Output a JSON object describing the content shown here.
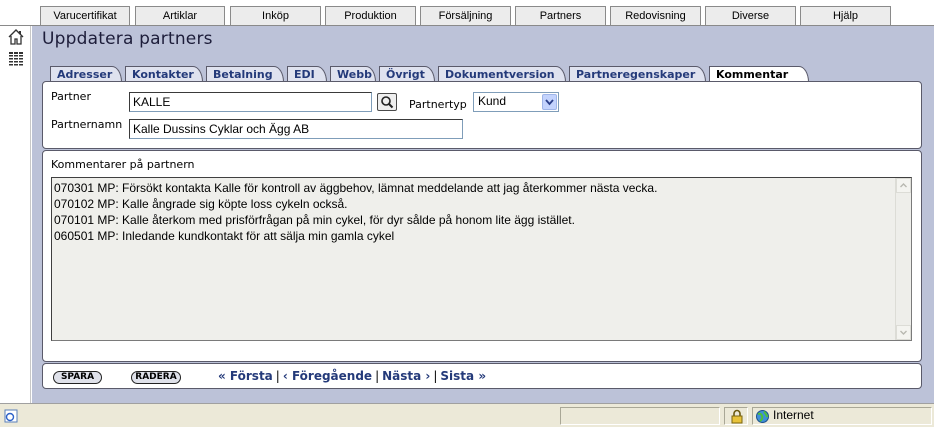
{
  "menu": {
    "items": [
      {
        "label": "Varucertifikat"
      },
      {
        "label": "Artiklar"
      },
      {
        "label": "Inköp"
      },
      {
        "label": "Produktion"
      },
      {
        "label": "Försäljning"
      },
      {
        "label": "Partners"
      },
      {
        "label": "Redovisning"
      },
      {
        "label": "Diverse"
      },
      {
        "label": "Hjälp"
      }
    ]
  },
  "page": {
    "title": "Uppdatera partners"
  },
  "tabs": [
    {
      "label": "Adresser"
    },
    {
      "label": "Kontakter"
    },
    {
      "label": "Betalning"
    },
    {
      "label": "EDI"
    },
    {
      "label": "Webb"
    },
    {
      "label": "Övrigt"
    },
    {
      "label": "Dokumentversion"
    },
    {
      "label": "Partneregenskaper"
    },
    {
      "label": "Kommentar",
      "active": true
    }
  ],
  "form": {
    "partner_label": "Partner",
    "partner_value": "KALLE",
    "partnertyp_label": "Partnertyp",
    "partnertyp_value": "Kund",
    "partnernamn_label": "Partnernamn",
    "partnernamn_value": "Kalle Dussins Cyklar och Ägg AB"
  },
  "comments": {
    "label": "Kommentarer på partnern",
    "lines": [
      "070301 MP: Försökt kontakta Kalle för kontroll av äggbehov, lämnat meddelande att jag återkommer nästa vecka.",
      "070102 MP: Kalle ångrade sig köpte loss cykeln också.",
      "070101 MP: Kalle återkom med prisförfrågan på min cykel, för dyr sålde på honom lite ägg istället.",
      "060501 MP: Inledande kundkontakt för att sälja min gamla cykel"
    ]
  },
  "actions": {
    "save_label": "SPARA",
    "delete_label": "RADERA",
    "first_label": "« Första",
    "prev_label": "‹ Föregående",
    "next_label": "Nästa ›",
    "last_label": "Sista »",
    "sep": "|"
  },
  "status": {
    "zone_label": "Internet"
  },
  "colors": {
    "content_bg": "#bcc2d8",
    "link": "#243a7a"
  }
}
